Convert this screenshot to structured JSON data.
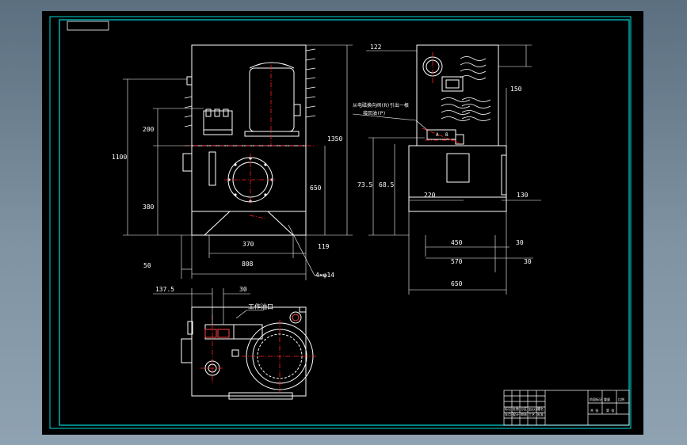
{
  "colors": {
    "background": "#000000",
    "frame": "#00d8d8",
    "outline": "#ffffff",
    "center_line": "#ff2020",
    "dimension": "#ffffff",
    "hatch": "#d0d0d0"
  },
  "front_view": {
    "dims": {
      "d1100": "1100",
      "d200": "200",
      "d380": "380",
      "d1350": "1350",
      "d650": "650",
      "d370": "370",
      "d119": "119",
      "d50": "50",
      "d808": "808"
    },
    "note_foot_holes": "4×φ14"
  },
  "side_view": {
    "dims": {
      "d122": "122",
      "d150": "150",
      "d735": "73.5",
      "d685": "68.5",
      "d220": "220",
      "d130": "130",
      "d450": "450",
      "d30a": "30",
      "d570": "570",
      "d30b": "30",
      "d650": "650"
    },
    "annotation_line1": "从电磁换向阀(R)引出一根",
    "annotation_line2": "接回油(P)",
    "valve_labels": [
      "A",
      "B"
    ]
  },
  "top_view": {
    "dims": {
      "d1375": "137.5",
      "d30": "30"
    },
    "port_label": "工作油口"
  },
  "title_block": {
    "cells": [
      "标记",
      "处数",
      "分区",
      "更改文件号",
      "签名",
      "年月日",
      "设计",
      "审核",
      "工艺",
      "批准"
    ],
    "right_cells": [
      "阶段标记",
      "重量",
      "比例"
    ],
    "right_cells_bottom": [
      "共 张",
      "第 张"
    ]
  }
}
